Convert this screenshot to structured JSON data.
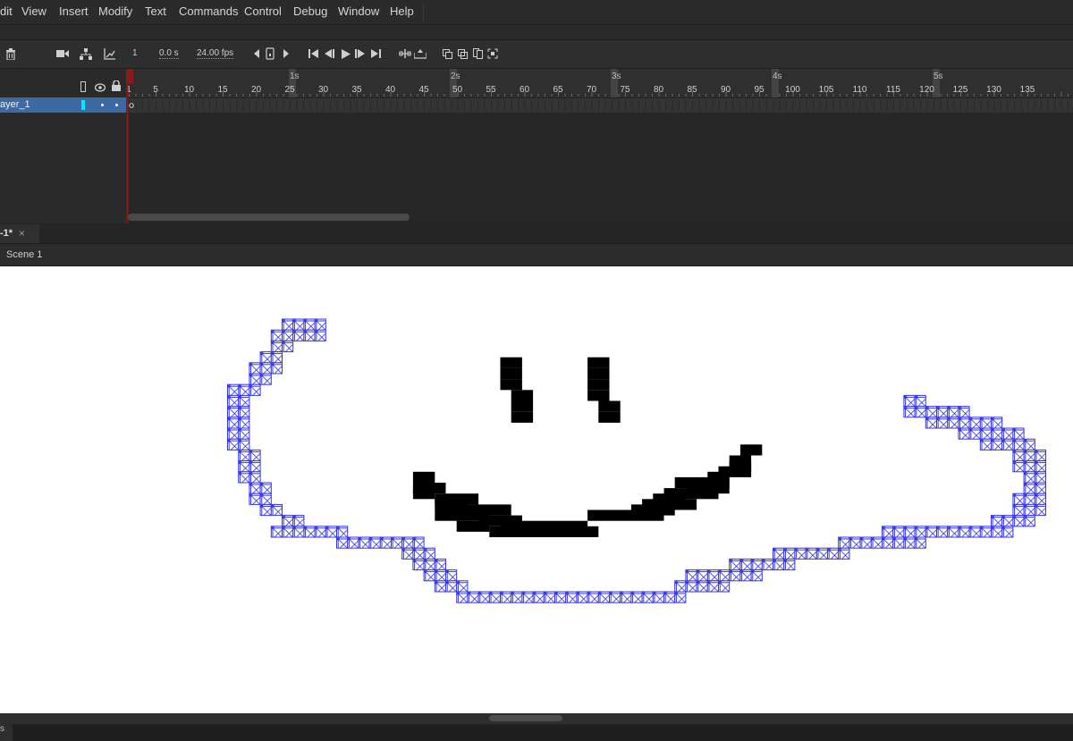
{
  "menu": [
    "dit",
    "View",
    "Insert",
    "Modify",
    "Text",
    "Commands",
    "Control",
    "Debug",
    "Window",
    "Help"
  ],
  "timeline": {
    "current_frame": "1",
    "time": "0.0 s",
    "fps": "24.00 fps",
    "frame_ticks": [
      "1",
      "5",
      "10",
      "15",
      "20",
      "25",
      "30",
      "35",
      "40",
      "45",
      "50",
      "55",
      "60",
      "65",
      "70",
      "75",
      "80",
      "85",
      "90",
      "95",
      "100",
      "105",
      "110",
      "115",
      "120",
      "125",
      "130",
      "135"
    ],
    "second_labels": [
      "1s",
      "2s",
      "3s",
      "4s",
      "5s"
    ],
    "layer_name": "ayer_1"
  },
  "document_tab": {
    "title": "-1*",
    "close": "×"
  },
  "breadcrumb": {
    "scene": "Scene 1"
  },
  "status": {
    "left_label": "s"
  },
  "colors": {
    "selection_blue": "#3535e0",
    "stroke_black": "#000000",
    "layer_accent": "#00e5ff",
    "playhead": "#8b1a1a"
  },
  "icons": [
    "trash-icon",
    "camera-icon",
    "layer-parent-icon",
    "graph-icon",
    "step-back-icon",
    "loop-icon",
    "step-forward-icon",
    "go-first-icon",
    "prev-frame-icon",
    "play-icon",
    "next-frame-icon",
    "go-last-icon",
    "center-frame-icon",
    "onion-skin-icon",
    "edit-multiple-icon",
    "outline-icon",
    "eye-icon",
    "lock-icon"
  ]
}
